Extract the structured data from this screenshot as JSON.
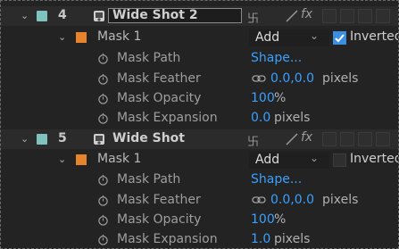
{
  "layers": [
    {
      "number": "4",
      "name": "Wide Shot 2",
      "selected_name_box": true,
      "mask": {
        "name": "Mask 1",
        "mode": "Add",
        "inverted_checked": true,
        "inverted_label": "Inverted",
        "properties": [
          {
            "label": "Mask Path",
            "value": "Shape..."
          },
          {
            "label": "Mask Feather",
            "value": "0.0,0.0",
            "unit": "pixels"
          },
          {
            "label": "Mask Opacity",
            "value": "100",
            "unit": "%"
          },
          {
            "label": "Mask Expansion",
            "value": "0.0",
            "unit": "pixels"
          }
        ]
      }
    },
    {
      "number": "5",
      "name": "Wide Shot",
      "selected_name_box": false,
      "mask": {
        "name": "Mask 1",
        "mode": "Add",
        "inverted_checked": false,
        "inverted_label": "Inverted",
        "properties": [
          {
            "label": "Mask Path",
            "value": "Shape..."
          },
          {
            "label": "Mask Feather",
            "value": "0.0,0.0",
            "unit": "pixels"
          },
          {
            "label": "Mask Opacity",
            "value": "100",
            "unit": "%"
          },
          {
            "label": "Mask Expansion",
            "value": "1.0",
            "unit": "pixels"
          }
        ]
      }
    }
  ],
  "colors": {
    "background": "#232323",
    "layer_row": "#2b2b2b",
    "label_teal": "#7fc2bf",
    "mask_orange": "#e7832a",
    "value_blue": "#3aa0ff",
    "checkbox_blue": "#3b8fe0"
  },
  "icons": {
    "twirl_down": "chevron-down-icon",
    "stopwatch": "stopwatch-icon",
    "link": "link-icon",
    "footage": "footage-icon",
    "shy": "shy-icon",
    "fx": "fx-icon"
  }
}
